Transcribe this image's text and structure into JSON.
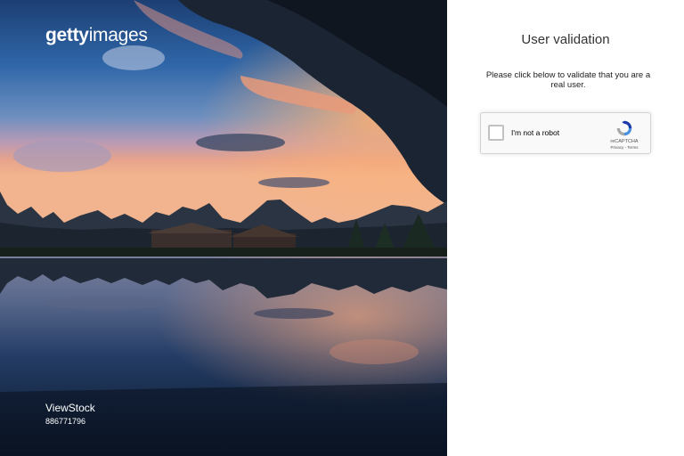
{
  "hero": {
    "logo": {
      "bold": "getty",
      "light": "images"
    },
    "credit": {
      "name": "ViewStock",
      "id": "886771796"
    }
  },
  "validation": {
    "title": "User validation",
    "instructions": "Please click below to validate that you are a real user.",
    "recaptcha": {
      "checkbox_label": "I'm not a robot",
      "brand": "reCAPTCHA",
      "privacy_link": "Privacy",
      "separator": "-",
      "terms_link": "Terms"
    }
  },
  "colors": {
    "panel_background": "#ffffff",
    "title_text": "#333333",
    "recaptcha_blue": "#4a90e2",
    "recaptcha_gray": "#a6a6a6"
  },
  "icons": [
    "recaptcha-logo-icon"
  ]
}
